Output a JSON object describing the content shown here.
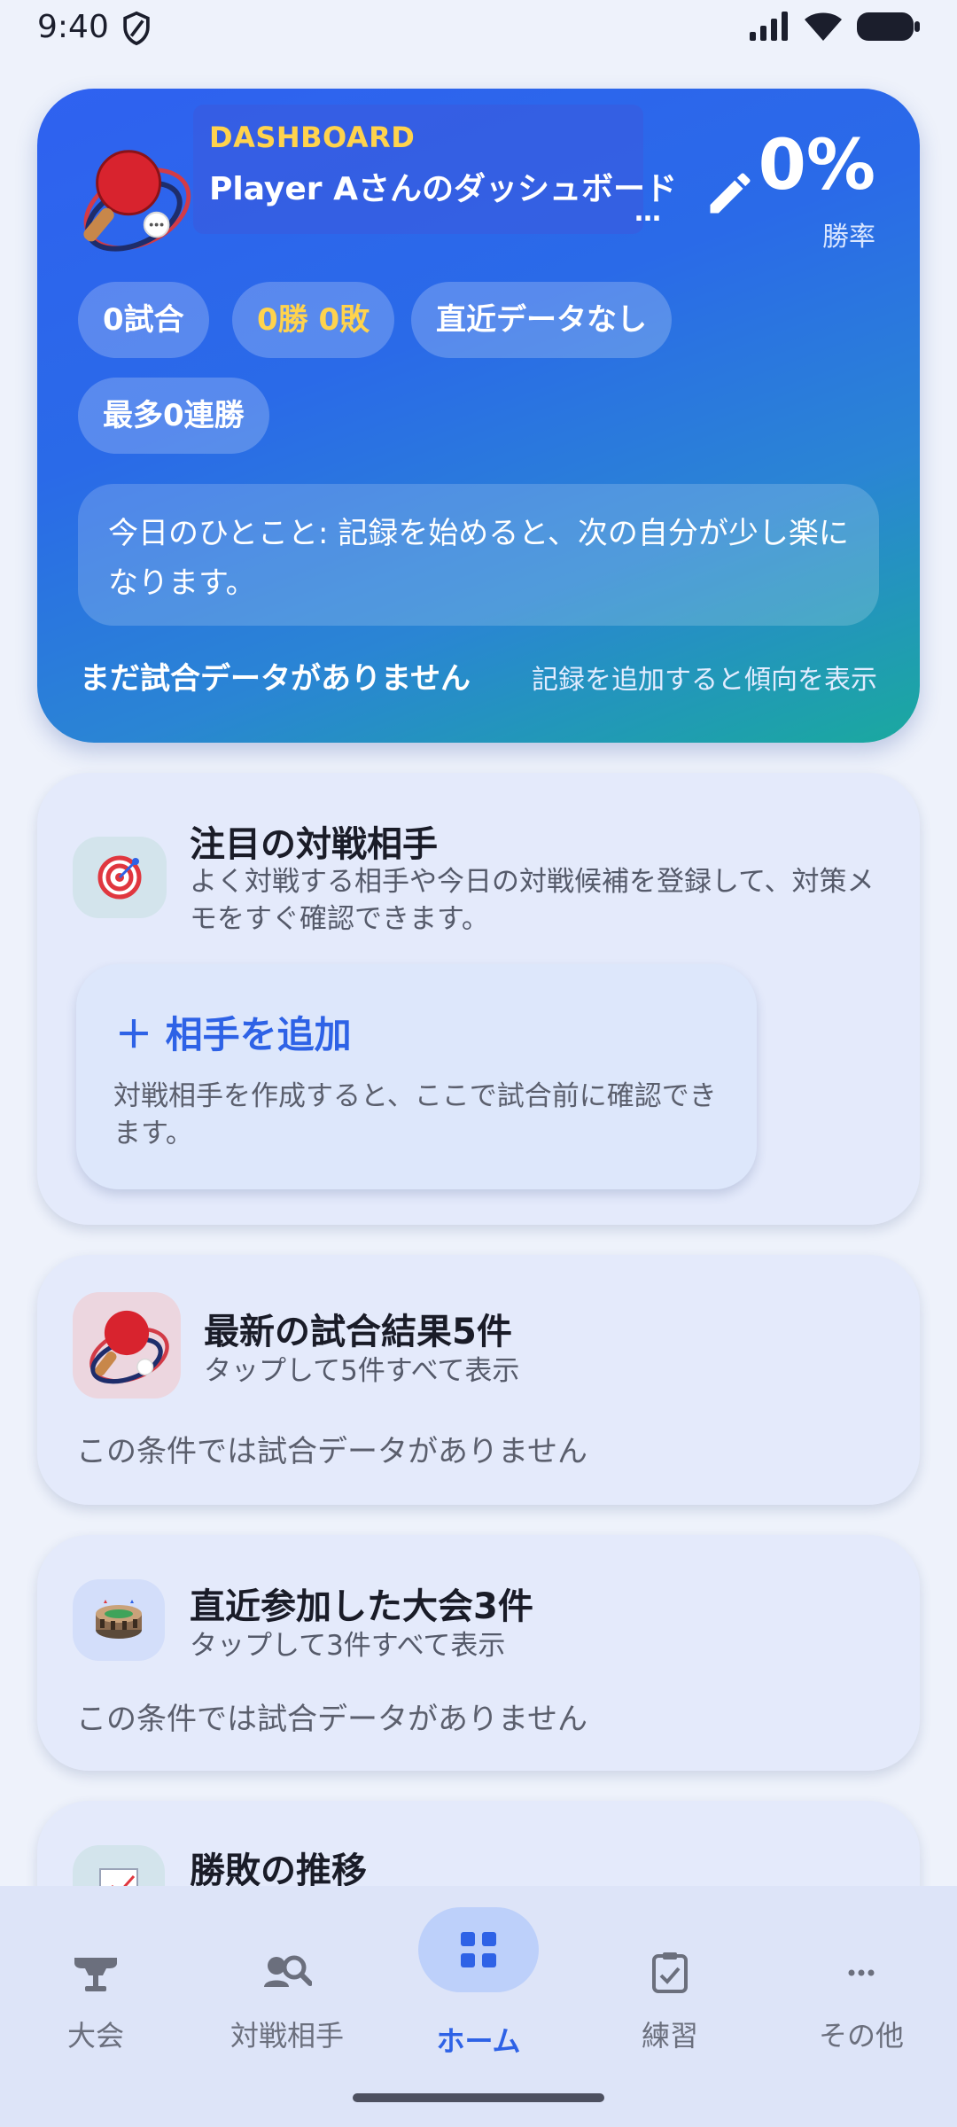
{
  "status": {
    "time": "9:40"
  },
  "hero": {
    "overline": "DASHBOARD",
    "title": "Player Aさんのダッシュボード",
    "more": "…",
    "win_rate_value": "0%",
    "win_rate_label": "勝率",
    "chips": {
      "matches": "0試合",
      "record": "0勝 0敗",
      "recent": "直近データなし",
      "streak": "最多0連勝"
    },
    "quote": "今日のひとこと: 記録を始めると、次の自分が少し楽になります。",
    "empty_title": "まだ試合データがありません",
    "empty_hint": "記録を追加すると傾向を表示"
  },
  "opponents": {
    "title": "注目の対戦相手",
    "subtitle": "よく対戦する相手や今日の対戦候補を登録して、対策メモをすぐ確認できます。",
    "add_label": "＋ 相手を追加",
    "add_desc": "対戦相手を作成すると、ここで試合前に確認できます。"
  },
  "results": {
    "title": "最新の試合結果5件",
    "subtitle": "タップして5件すべて表示",
    "empty": "この条件では試合データがありません"
  },
  "tournaments": {
    "title": "直近参加した大会3件",
    "subtitle": "タップして3件すべて表示",
    "empty": "この条件では試合データがありません"
  },
  "trend": {
    "title": "勝敗の推移"
  },
  "nav": {
    "items": [
      {
        "label": "大会",
        "icon": "trophy-icon"
      },
      {
        "label": "対戦相手",
        "icon": "opponent-search-icon"
      },
      {
        "label": "ホーム",
        "icon": "grid-icon",
        "active": true
      },
      {
        "label": "練習",
        "icon": "clipboard-check-icon"
      },
      {
        "label": "その他",
        "icon": "more-icon"
      }
    ]
  },
  "colors": {
    "accent": "#2e62e6",
    "highlight": "#ffd34d",
    "hero_gradient_start": "#2f61f0",
    "hero_gradient_end": "#1aa99f"
  }
}
